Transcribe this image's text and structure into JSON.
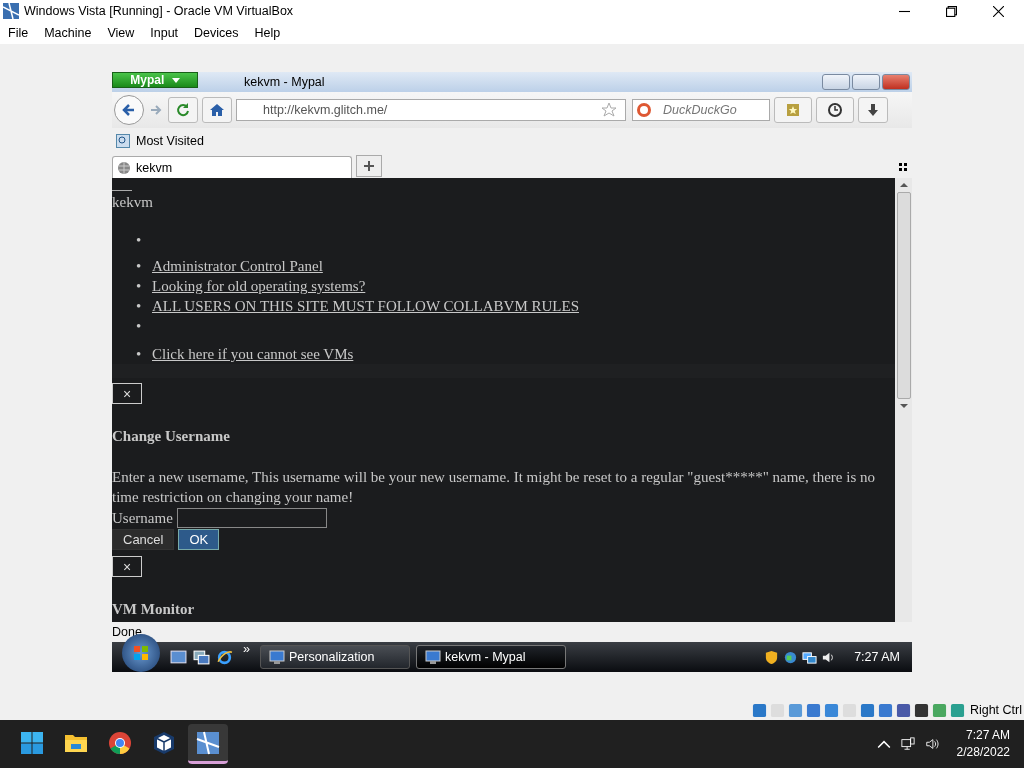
{
  "host": {
    "title": "Windows Vista [Running] - Oracle VM VirtualBox",
    "menu": [
      "File",
      "Machine",
      "View",
      "Input",
      "Devices",
      "Help"
    ],
    "host_key": "Right Ctrl"
  },
  "browser": {
    "app_button": "Mypal",
    "title": "kekvm - Mypal",
    "url": "http://kekvm.glitch.me/",
    "search_placeholder": "DuckDuckGo",
    "bookmarks": [
      "Most Visited"
    ],
    "tabs": [
      {
        "label": "kekvm",
        "selected": true
      }
    ],
    "page": {
      "site_title": "kekvm",
      "nav_items": [
        {
          "kind": "empty",
          "marker": "•"
        },
        {
          "kind": "link",
          "marker": "•",
          "label": "Administrator Control Panel"
        },
        {
          "kind": "link",
          "marker": "•",
          "label": "Looking for old operating systems?"
        },
        {
          "kind": "link",
          "marker": "•",
          "label": "ALL USERS ON THIS SITE MUST FOLLOW COLLABVM RULES"
        },
        {
          "kind": "empty",
          "marker": "•"
        },
        {
          "kind": "link",
          "marker": "•",
          "label": "Click here if you cannot see VMs"
        }
      ],
      "dialogs": [
        {
          "close": "×",
          "heading": "Change Username",
          "text": "Enter a new username, This username will be your new username. It might be reset to a regular \"guest*****\" name, there is no time restriction on changing your name!",
          "field_label": "Username",
          "buttons": [
            {
              "label": "Cancel",
              "kind": "secondary"
            },
            {
              "label": "OK",
              "kind": "primary"
            }
          ]
        },
        {
          "close": "×",
          "heading": "VM Monitor"
        }
      ]
    },
    "status": "Done"
  },
  "vista_taskbar": {
    "overflow": "»",
    "tasks": [
      {
        "label": "Personalization",
        "selected": false
      },
      {
        "label": "kekvm - Mypal",
        "selected": true
      }
    ],
    "clock": "7:27 AM"
  },
  "win_taskbar": {
    "apps": [
      {
        "selected": false
      },
      {
        "selected": false
      },
      {
        "selected": false
      },
      {
        "selected": false
      },
      {
        "selected": true
      }
    ],
    "time": "7:27 AM",
    "date": "2/28/2022"
  }
}
